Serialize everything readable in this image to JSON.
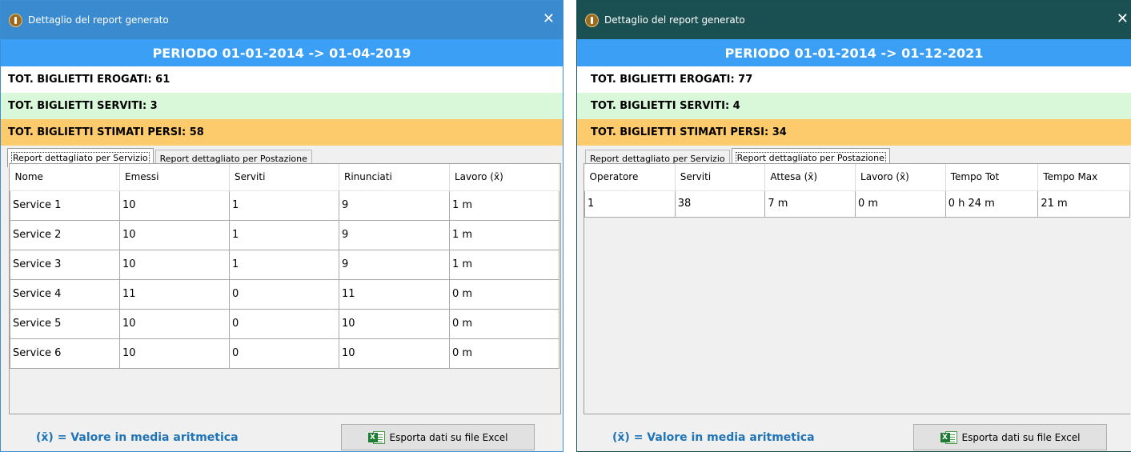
{
  "left": {
    "title": "Dettaglio del report generato",
    "close": "✕",
    "period": "PERIODO 01-01-2014 -> 01-04-2019",
    "erogati": "TOT. BIGLIETTI EROGATI: 61",
    "serviti": "TOT. BIGLIETTI SERVITI: 3",
    "persi": "TOT. BIGLIETTI STIMATI PERSI: 58",
    "tabs": [
      "Report dettagliato per Servizio",
      "Report dettagliato per Postazione"
    ],
    "active_tab": 0,
    "columns": [
      "Nome",
      "Emessi",
      "Serviti",
      "Rinunciati",
      "Lavoro (x̄)"
    ],
    "rows": [
      [
        "Service 1",
        "10",
        "1",
        "9",
        "1 m"
      ],
      [
        "Service 2",
        "10",
        "1",
        "9",
        "1 m"
      ],
      [
        "Service 3",
        "10",
        "1",
        "9",
        "1 m"
      ],
      [
        "Service 4",
        "11",
        "0",
        "11",
        "0 m"
      ],
      [
        "Service 5",
        "10",
        "0",
        "10",
        "0 m"
      ],
      [
        "Service 6",
        "10",
        "0",
        "10",
        "0 m"
      ]
    ],
    "footer_note": "(x̄) = Valore in media aritmetica",
    "export_label": "Esporta dati su file Excel"
  },
  "right": {
    "title": "Dettaglio del report generato",
    "close": "✕",
    "period": "PERIODO 01-01-2014 -> 01-12-2021",
    "erogati": "TOT. BIGLIETTI EROGATI: 77",
    "serviti": "TOT. BIGLIETTI SERVITI: 4",
    "persi": "TOT. BIGLIETTI STIMATI PERSI: 34",
    "tabs": [
      "Report dettagliato per Servizio",
      "Report dettagliato per Postazione"
    ],
    "active_tab": 1,
    "columns": [
      "Operatore",
      "Serviti",
      "Attesa (x̄)",
      "Lavoro (x̄)",
      "Tempo Tot",
      "Tempo Max"
    ],
    "rows": [
      [
        "1",
        "38",
        "7 m",
        "0 m",
        "0 h  24 m",
        "21 m"
      ]
    ],
    "footer_note": "(x̄) = Valore in media aritmetica",
    "export_label": "Esporta dati su file Excel"
  },
  "colors": {
    "left_titlebar": "#3a8ad0",
    "right_titlebar": "#1b5052",
    "period_bar": "#3a9ff5",
    "serviti_bg": "#d9f7d9",
    "persi_bg": "#fdcb6c",
    "footer_text": "#1f73b7"
  },
  "icons": {
    "title_icon": "info-icon",
    "export_icon": "excel-icon"
  }
}
